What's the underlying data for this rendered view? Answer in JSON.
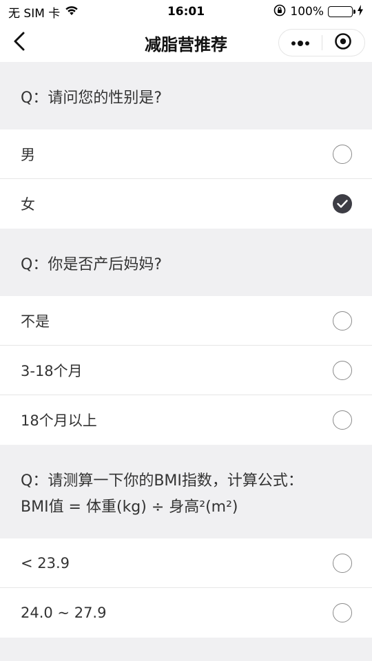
{
  "status_bar": {
    "carrier": "无 SIM 卡",
    "time": "16:01",
    "battery_text": "100%",
    "battery_level": 1.0,
    "icons": [
      "wifi-icon",
      "orientation-lock-icon",
      "battery-icon",
      "charging-icon"
    ]
  },
  "nav": {
    "title": "减脂营推荐",
    "back_icon": "chevron-left-icon",
    "more_icon": "more-dots-icon",
    "close_icon": "target-close-icon"
  },
  "questions": [
    {
      "text": "Q：请问您的性别是?",
      "options": [
        {
          "label": "男",
          "checked": false
        },
        {
          "label": "女",
          "checked": true
        }
      ]
    },
    {
      "text": "Q：你是否产后妈妈?",
      "options": [
        {
          "label": "不是",
          "checked": false
        },
        {
          "label": "3-18个月",
          "checked": false
        },
        {
          "label": "18个月以上",
          "checked": false
        }
      ]
    },
    {
      "text_line1": "Q：请测算一下你的BMI指数，计算公式：",
      "text_line2": "BMI值 = 体重(kg) ÷ 身高²(m²)",
      "options": [
        {
          "label": "< 23.9",
          "checked": false
        },
        {
          "label": "24.0 ~ 27.9",
          "checked": false
        }
      ]
    }
  ],
  "colors": {
    "checked_radio": "#3d3d45",
    "section_bg": "#f0f0f2",
    "battery_green": "#4cd964"
  }
}
